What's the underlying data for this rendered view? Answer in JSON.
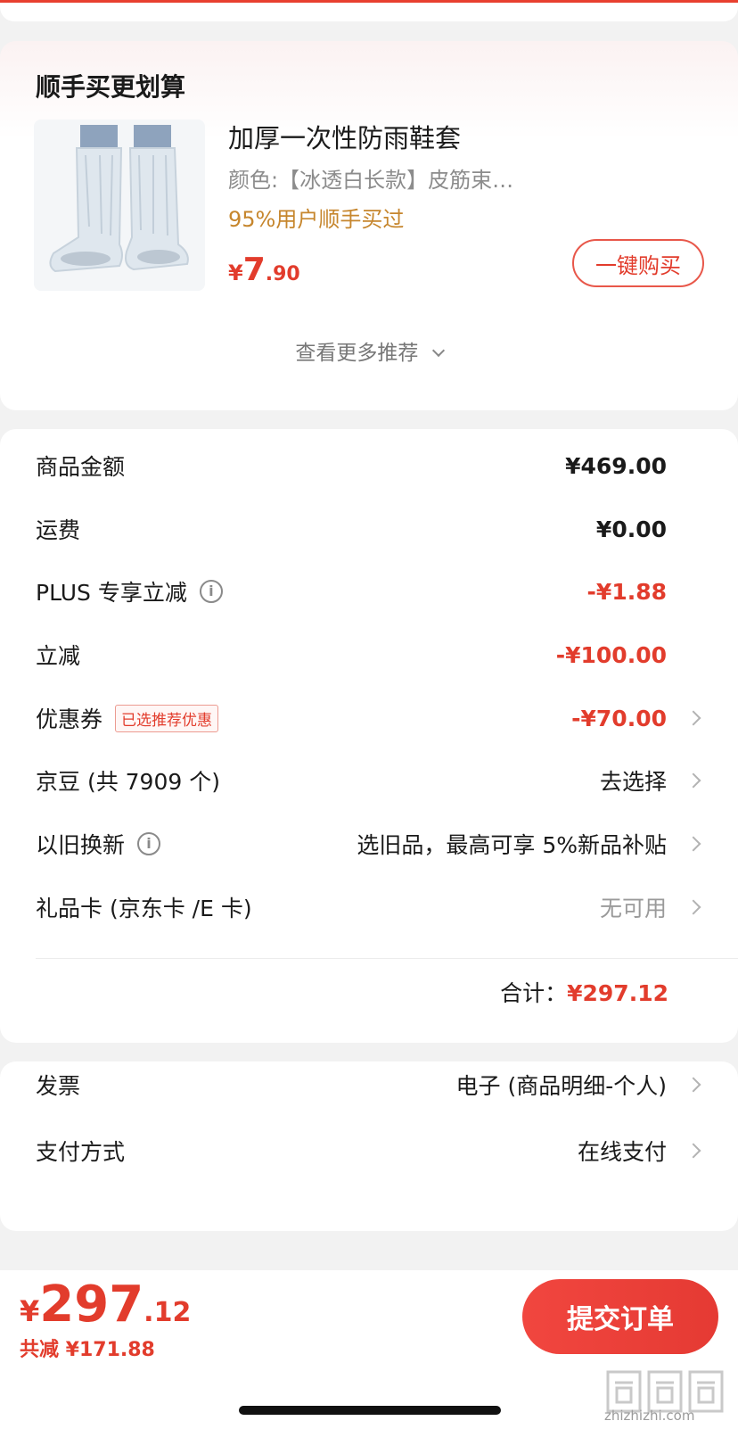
{
  "recommend": {
    "title": "顺手买更划算",
    "product": {
      "name": "加厚一次性防雨鞋套",
      "spec": "颜色:【冰透白长款】皮筋束…",
      "tag": "95%用户顺手买过",
      "price_symbol": "¥",
      "price_int": "7",
      "price_dec": ".90",
      "image_icon": "rain-shoe-cover-image"
    },
    "buy_button": "一键购买",
    "more_link": "查看更多推荐"
  },
  "fees": {
    "rows": [
      {
        "label": "商品金额",
        "value": "¥469.00"
      },
      {
        "label": "运费",
        "value": "¥0.00"
      },
      {
        "label": "PLUS 专享立减",
        "value": "-¥1.88"
      },
      {
        "label": "立减",
        "value": "-¥100.00"
      },
      {
        "label": "优惠券",
        "badge": "已选推荐优惠",
        "value": "-¥70.00"
      },
      {
        "label": "京豆 (共 7909 个)",
        "value": "去选择"
      },
      {
        "label": "以旧换新",
        "value": "选旧品，最高可享 5%新品补贴"
      },
      {
        "label": "礼品卡 (京东卡 /E 卡)",
        "value": "无可用"
      }
    ],
    "info_icon": "i",
    "total_label": "合计：",
    "total_value": "¥297.12"
  },
  "invoice": {
    "rows": [
      {
        "label": "发票",
        "value": "电子 (商品明细-个人)"
      },
      {
        "label": "支付方式",
        "value": "在线支付"
      }
    ]
  },
  "bottom": {
    "price_symbol": "¥",
    "price_int": "297",
    "price_dec": ".12",
    "saving": "共减 ¥171.88",
    "submit": "提交订单"
  },
  "watermark": "zhizhizhi.com",
  "colors": {
    "accent": "#e23c2c",
    "tag_orange": "#c6862d",
    "button_red": "#e53a33"
  }
}
